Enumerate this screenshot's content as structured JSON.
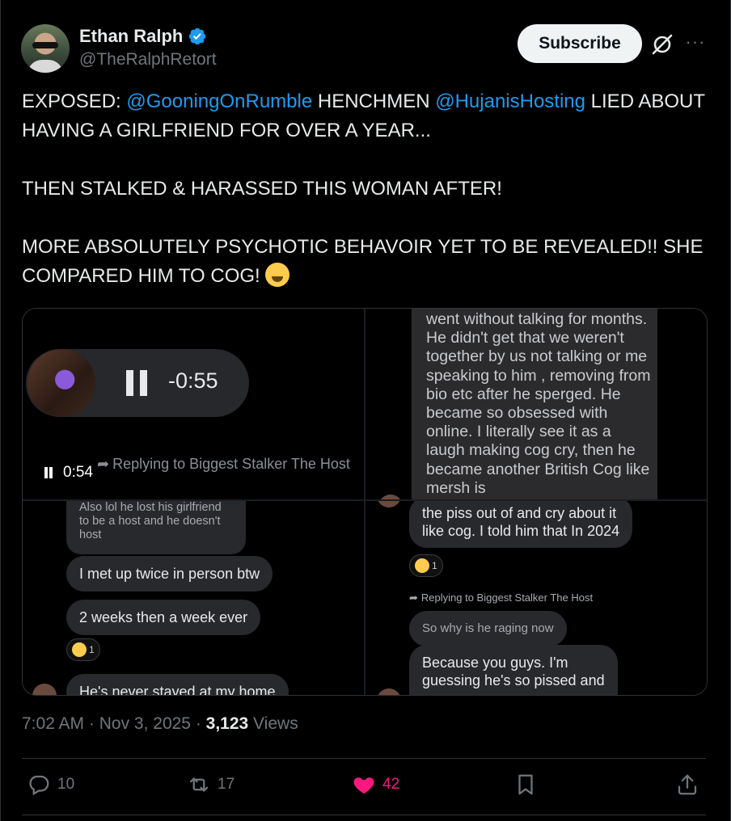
{
  "author": {
    "name": "Ethan Ralph",
    "handle": "@TheRalphRetort",
    "verified": true
  },
  "header": {
    "subscribe_label": "Subscribe",
    "grok_icon": "grok-icon",
    "more_icon": "more-icon"
  },
  "tweet": {
    "line1_prefix": "EXPOSED: ",
    "mention1": "@GooningOnRumble",
    "line1_mid": " HENCHMEN ",
    "mention2": "@HujanisHosting",
    "line1_suffix": " LIED ABOUT HAVING A GIRLFRIEND FOR OVER A YEAR...",
    "paragraph2": "THEN STALKED & HARASSED THIS WOMAN AFTER!",
    "paragraph3": "MORE ABSOLUTELY PSYCHOTIC BEHAVOIR YET TO BE REVEALED!! SHE COMPARED HIM TO COG!",
    "emoji": "laughing-face"
  },
  "media": {
    "audio": {
      "remaining": "-0:55"
    },
    "video": {
      "elapsed": "0:54"
    },
    "q1_reply_ghost": "Replying to Biggest Stalker The Host",
    "q2_message": "went without talking for months. He didn't get that we weren't together by us not talking or me speaking to him , removing from bio etc after he sperged. He became so obsessed with online. I literally see it as a laugh making cog cry, then he became another British Cog like mersh is",
    "q3": {
      "dim_message": "Also lol he lost his girlfriend to be a host and he doesn't host",
      "msg1": "I met up twice in person btw",
      "msg2": "2 weeks then a week ever",
      "reaction_count": "1",
      "msg3": "He's never stayed at my home"
    },
    "q4": {
      "msg1_line1": "the piss out of and cry about it",
      "msg1_line2": "like cog. I told him that In 2024",
      "reaction_count": "1",
      "reply_label": "Replying to Biggest Stalker The Host",
      "dim_message": "So why is he raging now",
      "msg2_line1": "Because you guys. I'm",
      "msg2_line2": "guessing he's so pissed and"
    }
  },
  "meta": {
    "time": "7:02 AM",
    "sep1": " · ",
    "date": "Nov 3, 2025",
    "sep2": " · ",
    "views_count": "3,123",
    "views_label": " Views"
  },
  "actions": {
    "replies": "10",
    "reposts": "17",
    "likes": "42",
    "like_color": "#f91880"
  }
}
